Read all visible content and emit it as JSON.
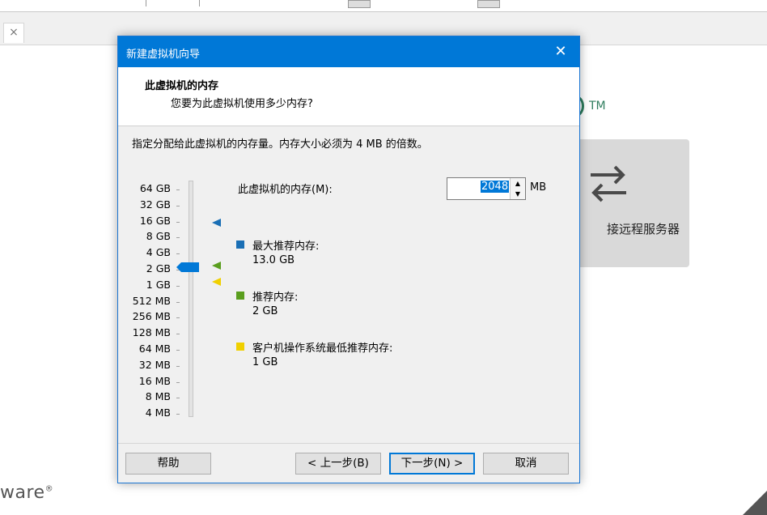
{
  "background": {
    "tab_close": "×",
    "tm_mark": "TM",
    "remote_card_label": "接远程服务器",
    "vmware_logo_fragment": "ware",
    "vmware_logo_mark": "®"
  },
  "dialog": {
    "title": "新建虚拟机向导",
    "close_glyph": "✕",
    "header_title": "此虚拟机的内存",
    "header_subtitle": "您要为此虚拟机使用多少内存?",
    "instruction": "指定分配给此虚拟机的内存量。内存大小必须为 4 MB 的倍数。",
    "memory_scale": [
      "64 GB",
      "32 GB",
      "16 GB",
      "8 GB",
      "4 GB",
      "2 GB",
      "1 GB",
      "512 MB",
      "256 MB",
      "128 MB",
      "64 MB",
      "32 MB",
      "16 MB",
      "8 MB",
      "4 MB"
    ],
    "memory_label": "此虚拟机的内存(M):",
    "memory_value": "2048",
    "memory_unit": "MB",
    "legend": {
      "max": {
        "label": "最大推荐内存:",
        "value": "13.0 GB",
        "color": "#1a6fb5"
      },
      "recommended": {
        "label": "推荐内存:",
        "value": "2 GB",
        "color": "#5a9e1e"
      },
      "min": {
        "label": "客户机操作系统最低推荐内存:",
        "value": "1 GB",
        "color": "#f0d000"
      }
    },
    "buttons": {
      "help": "帮助",
      "back": "< 上一步(B)",
      "next": "下一步(N) >",
      "cancel": "取消"
    }
  },
  "colors": {
    "accent": "#0078d7",
    "dialog_bg": "#f0f0f0"
  }
}
